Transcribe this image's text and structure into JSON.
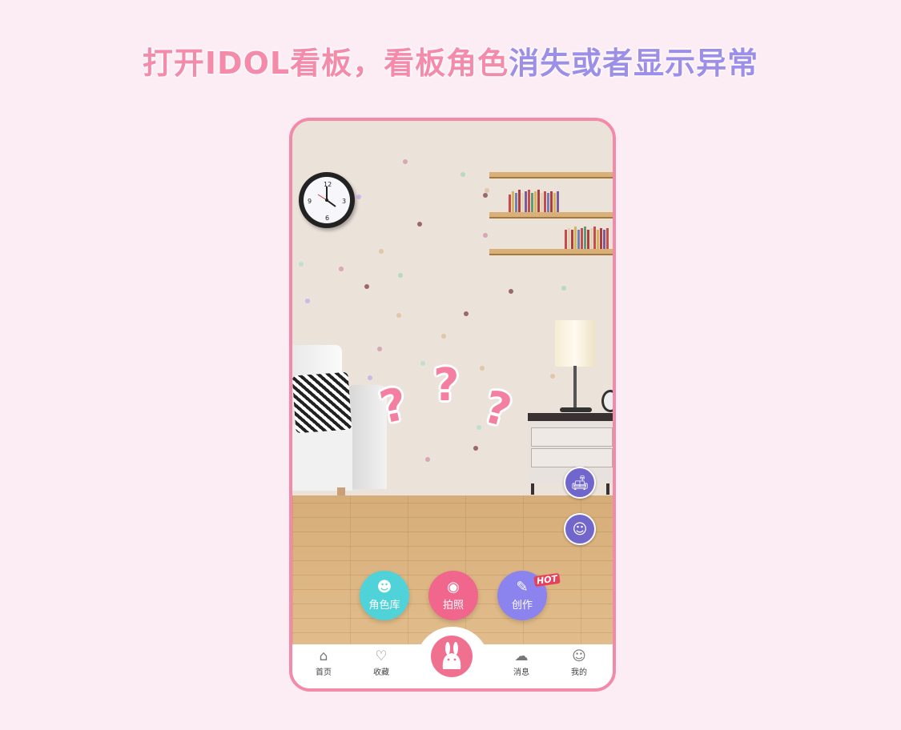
{
  "headline": {
    "part1": "打开IDOL看板，看板角色",
    "part2": "消失或者显示异常",
    "color1": "#f58bab",
    "color2": "#9d8ee8"
  },
  "overlay": {
    "question_marks": [
      "?",
      "?",
      "?"
    ]
  },
  "side_buttons": [
    {
      "icon": "sofa-icon",
      "glyph": "🛋"
    },
    {
      "icon": "person-icon",
      "glyph": "☺"
    }
  ],
  "actions": [
    {
      "label": "角色库",
      "icon": "character-icon",
      "glyph": "☻",
      "color": "#4fd3d9"
    },
    {
      "label": "拍照",
      "icon": "camera-icon",
      "glyph": "◉",
      "color": "#f0668c"
    },
    {
      "label": "创作",
      "icon": "edit-icon",
      "glyph": "✎",
      "color": "#8b84ee",
      "badge": "HOT"
    }
  ],
  "tabbar": {
    "items": [
      {
        "label": "首页",
        "icon": "home-icon",
        "glyph": "⌂"
      },
      {
        "label": "收藏",
        "icon": "favorite-icon",
        "glyph": "♡"
      },
      {
        "label": "消息",
        "icon": "message-icon",
        "glyph": "☁"
      },
      {
        "label": "我的",
        "icon": "profile-icon",
        "glyph": "☺"
      }
    ],
    "center_icon": "rabbit-icon"
  },
  "accent_color": "#f38aa9"
}
